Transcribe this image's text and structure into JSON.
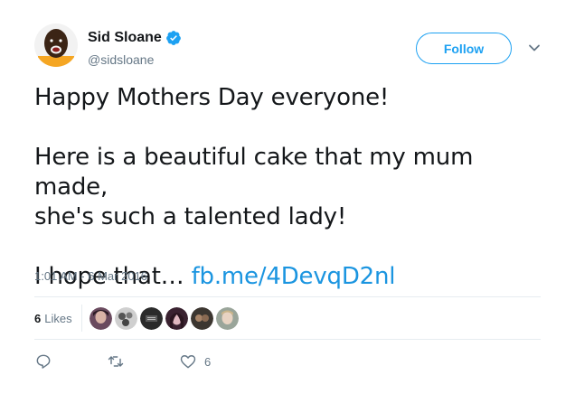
{
  "user": {
    "name": "Sid Sloane",
    "handle": "@sidsloane",
    "verified_icon": "verified-badge-icon",
    "colors": {
      "verified": "#1da1f2"
    }
  },
  "follow_button": {
    "label": "Follow"
  },
  "menu": {
    "icon": "chevron-down-icon"
  },
  "tweet": {
    "line1": "Happy Mothers Day everyone!",
    "line2": "Here is a beautiful cake that my mum made,",
    "line3": "she's such a talented lady!",
    "line4_prefix": "I hope that… ",
    "link_text": "fb.me/4DevqD2nl",
    "link_color": "#1b95e0"
  },
  "timestamp": "1:01 AM - 6 Mar 2016",
  "likes": {
    "count": "6",
    "label": "Likes",
    "likers": [
      "liker-1",
      "liker-2",
      "liker-3",
      "liker-4",
      "liker-5",
      "liker-6"
    ]
  },
  "actions": {
    "reply_icon": "reply-icon",
    "retweet_icon": "retweet-icon",
    "like_icon": "heart-icon",
    "like_count": "6"
  }
}
